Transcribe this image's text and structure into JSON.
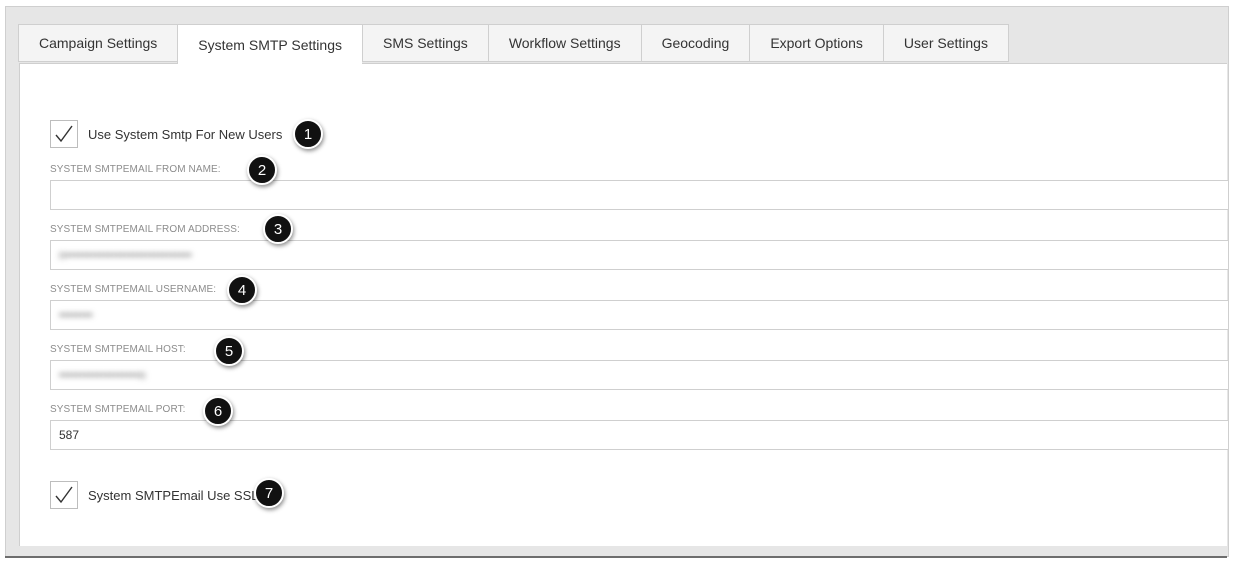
{
  "tabs": [
    {
      "label": "Campaign Settings",
      "active": false
    },
    {
      "label": "System SMTP Settings",
      "active": true
    },
    {
      "label": "SMS Settings",
      "active": false
    },
    {
      "label": "Workflow Settings",
      "active": false
    },
    {
      "label": "Geocoding",
      "active": false
    },
    {
      "label": "Export Options",
      "active": false
    },
    {
      "label": "User Settings",
      "active": false
    }
  ],
  "use_system_smtp": {
    "label": "Use System Smtp For New Users",
    "checked": true,
    "checkmark_icon": "checkmark-icon"
  },
  "fields": {
    "from_name": {
      "label": "SYSTEM SMTPEMAIL FROM NAME:",
      "value": ""
    },
    "from_address": {
      "label": "SYSTEM SMTPEMAIL FROM ADDRESS:",
      "value": "n••••••••••••••••••••••••••••••"
    },
    "username": {
      "label": "SYSTEM SMTPEMAIL USERNAME:",
      "value": "••••••••"
    },
    "host": {
      "label": "SYSTEM SMTPEMAIL HOST:",
      "value": "•••••••••••••••••••n"
    },
    "port": {
      "label": "SYSTEM SMTPEMAIL PORT:",
      "value": "587"
    }
  },
  "use_ssl": {
    "label": "System SMTPEmail Use SSL",
    "checked": true,
    "checkmark_icon": "checkmark-icon"
  },
  "callouts": [
    "1",
    "2",
    "3",
    "4",
    "5",
    "6",
    "7"
  ],
  "colors": {
    "badge": "#111111",
    "border": "#cfcfcf",
    "frame": "#e6e6e6"
  }
}
